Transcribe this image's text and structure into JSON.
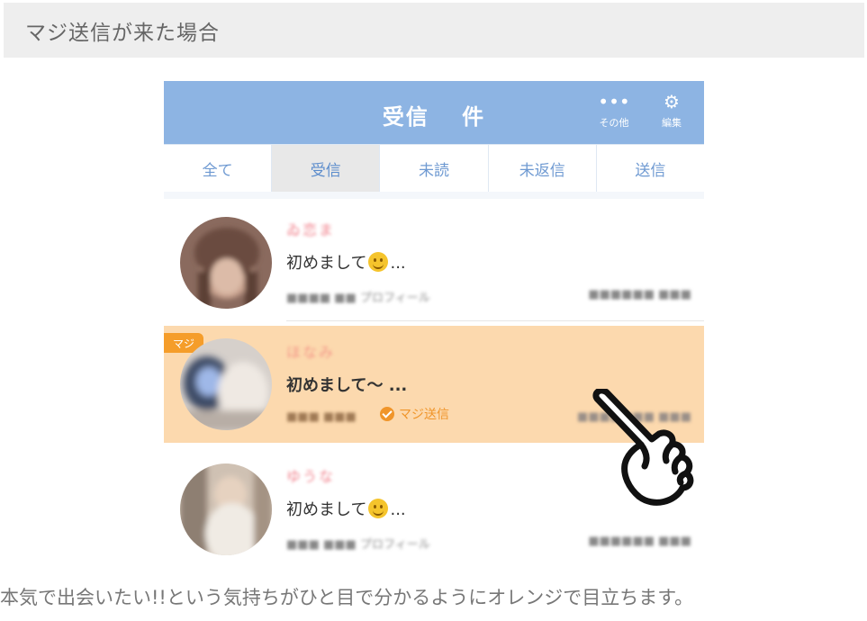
{
  "section": {
    "title": "マジ送信が来た場合"
  },
  "app": {
    "title": "受信　 件",
    "more_label": "その他",
    "edit_label": "編集",
    "more_icon": "•••",
    "edit_icon": "⚙"
  },
  "tabs": [
    {
      "label": "全て",
      "active": false
    },
    {
      "label": "受信",
      "active": true
    },
    {
      "label": "未読",
      "active": false
    },
    {
      "label": "未返信",
      "active": false
    },
    {
      "label": "送信",
      "active": false
    }
  ],
  "messages": [
    {
      "name": "ゐ恋ま",
      "text": "初めまして",
      "suffix": "...",
      "emoji": true,
      "meta": "■■■■ ■■ プロフィール",
      "date": "■■■■■■ ■■■",
      "maji": false
    },
    {
      "name": "ほなみ",
      "text": "初めまして～ ...",
      "suffix": "",
      "emoji": false,
      "meta": "■■■ ■■■",
      "status": "マジ送信",
      "badge": "マジ",
      "date": "■■■■■■■ ■■■",
      "maji": true
    },
    {
      "name": "ゆうな",
      "text": "初めまして",
      "suffix": "...",
      "emoji": true,
      "meta": "■■■ ■■■ プロフィール",
      "date": "■■■■■■ ■■■",
      "maji": false
    }
  ],
  "caption": "本気で出会いたい!!という気持ちがひと目で分かるようにオレンジで目立ちます。",
  "colors": {
    "header_blue": "#8db4e3",
    "maji_orange": "#fcd9ae",
    "accent_orange": "#f0952a"
  }
}
